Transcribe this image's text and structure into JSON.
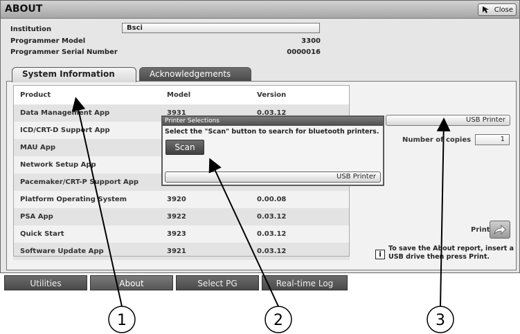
{
  "window": {
    "title": "ABOUT",
    "close_label": "Close"
  },
  "info": {
    "institution_label": "Institution",
    "institution_value": "Bsci",
    "model_label": "Programmer Model",
    "model_value": "3300",
    "serial_label": "Programmer Serial Number",
    "serial_value": "0000016"
  },
  "tabs": [
    {
      "label": "System Information",
      "active": true
    },
    {
      "label": "Acknowledgements",
      "active": false
    }
  ],
  "table": {
    "headers": [
      "Product",
      "Model",
      "Version"
    ],
    "rows": [
      {
        "product": "Data Management App",
        "model": "3931",
        "version": "0.03.12"
      },
      {
        "product": "ICD/CRT-D Support App",
        "model": "",
        "version": ""
      },
      {
        "product": "MAU App",
        "model": "",
        "version": ""
      },
      {
        "product": "Network Setup App",
        "model": "",
        "version": ""
      },
      {
        "product": "Pacemaker/CRT-P Support App",
        "model": "",
        "version": ""
      },
      {
        "product": "Platform Operating System",
        "model": "3920",
        "version": "0.00.08"
      },
      {
        "product": "PSA App",
        "model": "3922",
        "version": "0.03.12"
      },
      {
        "product": "Quick Start",
        "model": "3923",
        "version": "0.03.12"
      },
      {
        "product": "Software Update App",
        "model": "3921",
        "version": "0.03.12"
      }
    ]
  },
  "printer": {
    "selected": "USB Printer",
    "copies_label": "Number of copies",
    "copies_value": "1",
    "print_label": "Print",
    "hint": "To save the About report, insert a USB drive then press Print."
  },
  "dialog": {
    "title": "Printer Selections",
    "message": "Select the \"Scan\" button to search for bluetooth printers.",
    "scan_label": "Scan",
    "printer_option": "USB Printer"
  },
  "bottom_nav": [
    "Utilities",
    "About",
    "Select PG",
    "Real-time Log"
  ],
  "callouts": [
    "1",
    "2",
    "3"
  ],
  "colors": {
    "dark_tab": "#4a4a4a",
    "panel": "#f2f2f2",
    "header_bar": "#a6a6a6"
  }
}
